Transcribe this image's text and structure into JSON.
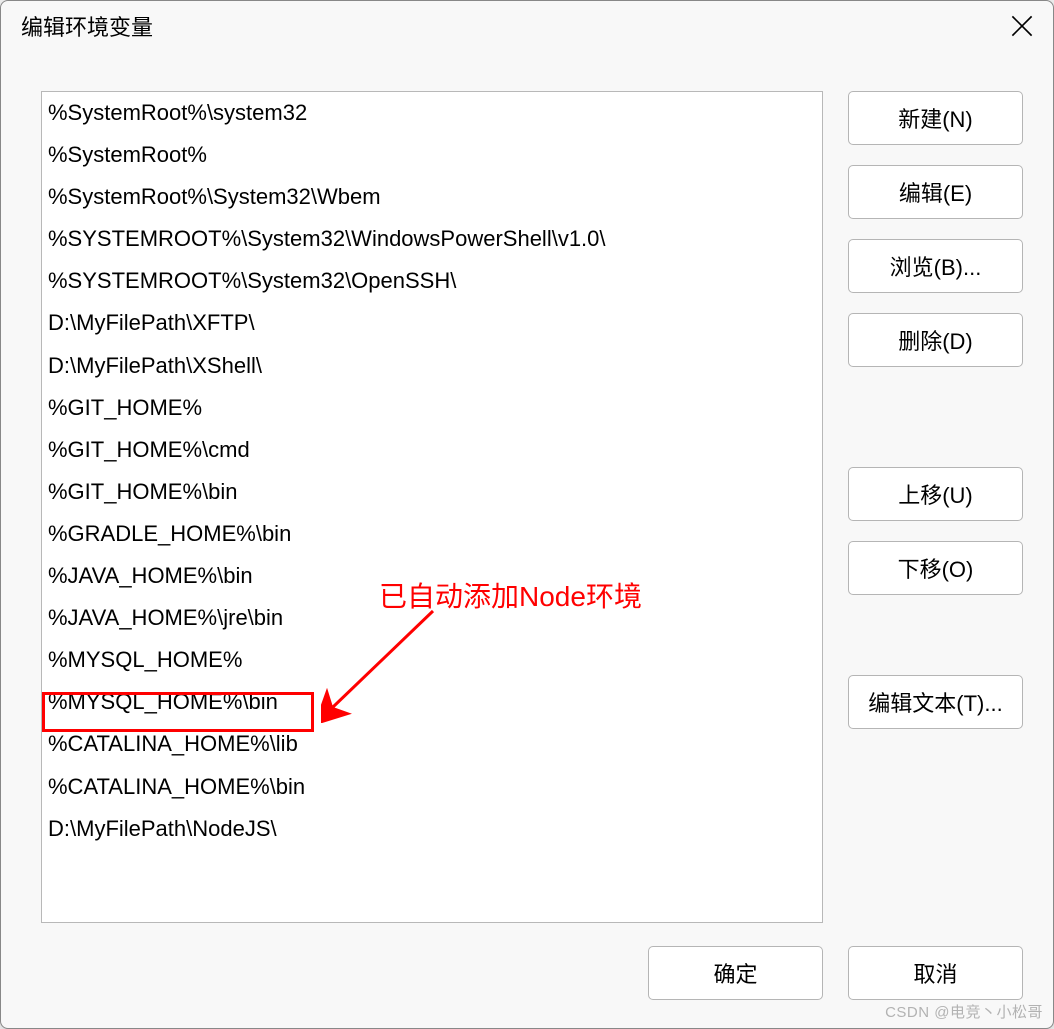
{
  "title": "编辑环境变量",
  "path_items": [
    "%SystemRoot%\\system32",
    "%SystemRoot%",
    "%SystemRoot%\\System32\\Wbem",
    "%SYSTEMROOT%\\System32\\WindowsPowerShell\\v1.0\\",
    "%SYSTEMROOT%\\System32\\OpenSSH\\",
    "D:\\MyFilePath\\XFTP\\",
    "D:\\MyFilePath\\XShell\\",
    "%GIT_HOME%",
    "%GIT_HOME%\\cmd",
    "%GIT_HOME%\\bin",
    "%GRADLE_HOME%\\bin",
    "%JAVA_HOME%\\bin",
    "%JAVA_HOME%\\jre\\bin",
    "%MYSQL_HOME%",
    "%MYSQL_HOME%\\bin",
    "%CATALINA_HOME%\\lib",
    "%CATALINA_HOME%\\bin",
    "D:\\MyFilePath\\NodeJS\\"
  ],
  "buttons": {
    "new": "新建(N)",
    "edit": "编辑(E)",
    "browse": "浏览(B)...",
    "delete": "删除(D)",
    "move_up": "上移(U)",
    "move_down": "下移(O)",
    "edit_text": "编辑文本(T)..."
  },
  "footer": {
    "ok": "确定",
    "cancel": "取消"
  },
  "annotation_text": "已自动添加Node环境",
  "watermark": "CSDN @电竞丶小松哥"
}
